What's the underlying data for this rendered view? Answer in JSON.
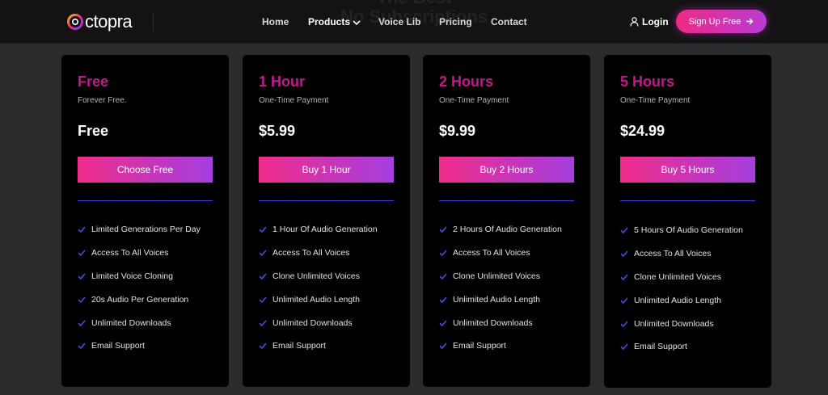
{
  "hero_ghost": {
    "line1": "The Best",
    "line2": "No Subscriptions"
  },
  "brand": {
    "name": "ctopra",
    "accent": "#ee2a86"
  },
  "nav": {
    "links": [
      {
        "label": "Home"
      },
      {
        "label": "Products"
      },
      {
        "label": "Voice Lib"
      },
      {
        "label": "Pricing"
      },
      {
        "label": "Contact"
      }
    ],
    "login": "Login",
    "signup": "Sign Up Free"
  },
  "plans": [
    {
      "name": "Free",
      "subtitle": "Forever Free.",
      "price": "Free",
      "button": "Choose Free",
      "features": [
        "Limited Generations Per Day",
        "Access To All Voices",
        "Limited Voice Cloning",
        "20s Audio Per Generation",
        "Unlimited Downloads",
        "Email Support"
      ]
    },
    {
      "name": "1 Hour",
      "subtitle": "One-Time Payment",
      "price": "$5.99",
      "button": "Buy 1 Hour",
      "features": [
        "1 Hour Of Audio Generation",
        "Access To All Voices",
        "Clone Unlimited Voices",
        "Unlimited Audio Length",
        "Unlimited Downloads",
        "Email Support"
      ]
    },
    {
      "name": "2 Hours",
      "subtitle": "One-Time Payment",
      "price": "$9.99",
      "button": "Buy 2 Hours",
      "features": [
        "2 Hours Of Audio Generation",
        "Access To All Voices",
        "Clone Unlimited Voices",
        "Unlimited Audio Length",
        "Unlimited Downloads",
        "Email Support"
      ]
    },
    {
      "name": "5 Hours",
      "subtitle": "One-Time Payment",
      "price": "$24.99",
      "button": "Buy 5 Hours",
      "features": [
        "5 Hours Of Audio Generation",
        "Access To All Voices",
        "Clone Unlimited Voices",
        "Unlimited Audio Length",
        "Unlimited Downloads",
        "Email Support"
      ]
    }
  ],
  "icons": {
    "check": "check-icon",
    "user": "user-icon",
    "arrow": "arrow-right-icon",
    "chevron": "chevron-down-icon"
  }
}
